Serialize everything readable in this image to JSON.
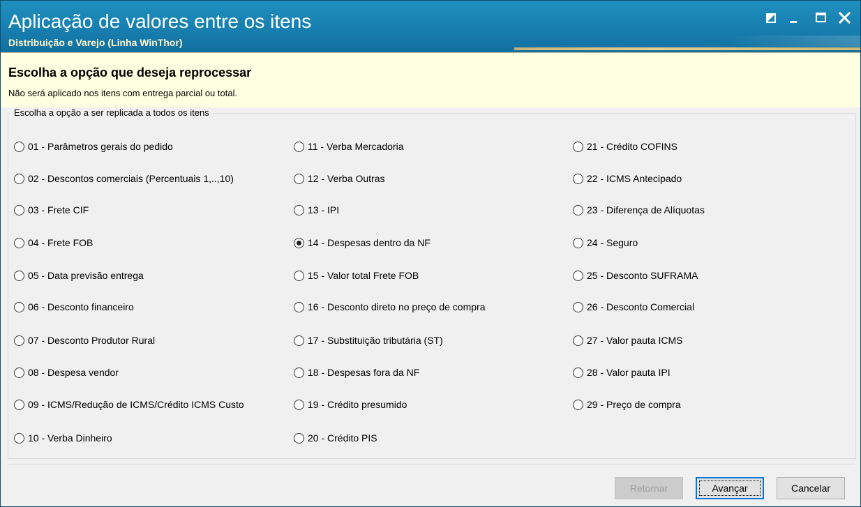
{
  "window": {
    "title": "Aplicação de valores entre os itens",
    "subtitle": "Distribuição e Varejo (Linha WinThor)",
    "controls": [
      "restore-icon",
      "minimize-icon",
      "maximize-icon",
      "close-icon"
    ]
  },
  "header": {
    "title": "Escolha a opção que deseja reprocessar",
    "subtitle": "Não será aplicado nos itens com entrega parcial ou total."
  },
  "group": {
    "legend": "Escolha a opção a ser replicada a todos os itens"
  },
  "options": [
    {
      "label": "01 - Parâmetros gerais do pedido",
      "checked": false
    },
    {
      "label": "02 - Descontos comerciais (Percentuais 1,..,10)",
      "checked": false
    },
    {
      "label": "03 - Frete CIF",
      "checked": false
    },
    {
      "label": "04 - Frete FOB",
      "checked": false
    },
    {
      "label": "05 - Data previsão entrega",
      "checked": false
    },
    {
      "label": "06 - Desconto financeiro",
      "checked": false
    },
    {
      "label": "07 - Desconto Produtor Rural",
      "checked": false
    },
    {
      "label": "08 - Despesa vendor",
      "checked": false
    },
    {
      "label": "09 - ICMS/Redução de ICMS/Crédito ICMS Custo",
      "checked": false
    },
    {
      "label": "10 - Verba Dinheiro",
      "checked": false
    },
    {
      "label": "11 - Verba Mercadoria",
      "checked": false
    },
    {
      "label": "12 - Verba Outras",
      "checked": false
    },
    {
      "label": "13 - IPI",
      "checked": false
    },
    {
      "label": "14 - Despesas dentro da NF",
      "checked": true
    },
    {
      "label": "15 - Valor total Frete FOB",
      "checked": false
    },
    {
      "label": "16 - Desconto direto no preço de compra",
      "checked": false
    },
    {
      "label": "17 - Substituição tributária (ST)",
      "checked": false
    },
    {
      "label": "18 - Despesas fora da NF",
      "checked": false
    },
    {
      "label": "19 - Crédito presumido",
      "checked": false
    },
    {
      "label": "20 - Crédito PIS",
      "checked": false
    },
    {
      "label": "21 - Crédito COFINS",
      "checked": false
    },
    {
      "label": "22 - ICMS Antecipado",
      "checked": false
    },
    {
      "label": "23 - Diferença de Alíquotas",
      "checked": false
    },
    {
      "label": "24 - Seguro",
      "checked": false
    },
    {
      "label": "25 - Desconto SUFRAMA",
      "checked": false
    },
    {
      "label": "26 - Desconto Comercial",
      "checked": false
    },
    {
      "label": "27 - Valor pauta ICMS",
      "checked": false
    },
    {
      "label": "28 - Valor pauta IPI",
      "checked": false
    },
    {
      "label": "29 - Preço de compra",
      "checked": false
    }
  ],
  "buttons": {
    "back": {
      "label": "Retornar",
      "disabled": true
    },
    "next": {
      "label": "Avançar",
      "disabled": false
    },
    "cancel": {
      "label": "Cancelar",
      "disabled": false
    }
  }
}
